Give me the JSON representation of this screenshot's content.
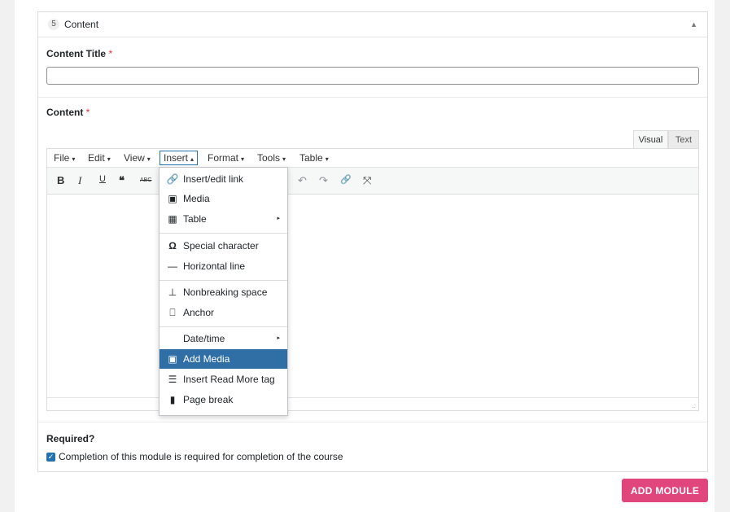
{
  "panel": {
    "step_number": "5",
    "title": "Content",
    "collapse_icon": "triangle-up-icon"
  },
  "content_title_field": {
    "label": "Content Title",
    "required_mark": "*",
    "value": ""
  },
  "content_field": {
    "label": "Content",
    "required_mark": "*"
  },
  "editor": {
    "tabs": {
      "visual": "Visual",
      "text": "Text"
    },
    "menus": [
      {
        "label": "File",
        "caret": "▾"
      },
      {
        "label": "Edit",
        "caret": "▾"
      },
      {
        "label": "View",
        "caret": "▾"
      },
      {
        "label": "Insert",
        "caret": "▴"
      },
      {
        "label": "Format",
        "caret": "▾"
      },
      {
        "label": "Tools",
        "caret": "▾"
      },
      {
        "label": "Table",
        "caret": "▾"
      }
    ],
    "toolbar": {
      "bold": "B",
      "italic": "I",
      "underline": "U",
      "blockquote": "❝",
      "strikethrough": "ABC",
      "undo": "↶",
      "redo": "↷",
      "link": "🔗",
      "fullscreen": "⤧"
    },
    "resize_handle": ".:"
  },
  "insert_menu": {
    "items": [
      {
        "label": "Insert/edit link",
        "icon": "🔗",
        "icon_name": "link-icon"
      },
      {
        "label": "Media",
        "icon": "▣",
        "icon_name": "media-icon"
      },
      {
        "label": "Table",
        "icon": "▦",
        "icon_name": "table-icon",
        "submenu": "▸"
      },
      {
        "label": "Special character",
        "icon": "Ω",
        "icon_name": "omega-icon"
      },
      {
        "label": "Horizontal line",
        "icon": "—",
        "icon_name": "horizontal-line-icon"
      },
      {
        "label": "Nonbreaking space",
        "icon": "⊥",
        "icon_name": "nonbreaking-space-icon"
      },
      {
        "label": "Anchor",
        "icon": "⎕",
        "icon_name": "bookmark-icon"
      },
      {
        "label": "Date/time",
        "icon": "",
        "icon_name": "",
        "submenu": "▸"
      },
      {
        "label": "Add Media",
        "icon": "▣",
        "icon_name": "add-media-icon",
        "highlighted": true
      },
      {
        "label": "Insert Read More tag",
        "icon": "☰",
        "icon_name": "read-more-icon"
      },
      {
        "label": "Page break",
        "icon": "▮",
        "icon_name": "page-break-icon"
      }
    ]
  },
  "required_section": {
    "label": "Required?",
    "checked": true,
    "checkbox_label": "Completion of this module is required for completion of the course"
  },
  "add_module_button": "ADD MODULE",
  "colors": {
    "accent": "#e0457b",
    "highlight": "#2f6fa6",
    "checkbox": "#2271b1",
    "required": "#d63638"
  }
}
